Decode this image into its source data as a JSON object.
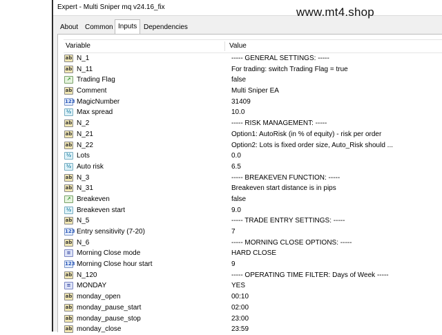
{
  "window": {
    "title": "Expert - Multi Sniper mq v24.16_fix",
    "watermark": "www.mt4.shop"
  },
  "tabs": [
    {
      "label": "About",
      "active": false
    },
    {
      "label": "Common",
      "active": false
    },
    {
      "label": "Inputs",
      "active": true
    },
    {
      "label": "Dependencies",
      "active": false
    }
  ],
  "table": {
    "headers": {
      "variable": "Variable",
      "value": "Value"
    },
    "rows": [
      {
        "icon": "ab",
        "name": "N_1",
        "value": "----- GENERAL SETTINGS: -----"
      },
      {
        "icon": "ab",
        "name": "N_11",
        "value": "For trading: switch Trading Flag = true"
      },
      {
        "icon": "bool",
        "name": "Trading Flag",
        "value": "false"
      },
      {
        "icon": "ab",
        "name": "Comment",
        "value": "Multi Sniper EA"
      },
      {
        "icon": "num",
        "name": "MagicNumber",
        "value": "31409"
      },
      {
        "icon": "dbl",
        "name": "Max spread",
        "value": "10.0"
      },
      {
        "icon": "ab",
        "name": "N_2",
        "value": "----- RISK MANAGEMENT: -----"
      },
      {
        "icon": "ab",
        "name": "N_21",
        "value": "Option1: AutoRisk (in % of equity) - risk per order"
      },
      {
        "icon": "ab",
        "name": "N_22",
        "value": "Option2: Lots is fixed order size, Auto_Risk should ..."
      },
      {
        "icon": "dbl",
        "name": "Lots",
        "value": "0.0"
      },
      {
        "icon": "dbl",
        "name": "Auto risk",
        "value": "6.5"
      },
      {
        "icon": "ab",
        "name": "N_3",
        "value": "-----  BREAKEVEN FUNCTION: -----"
      },
      {
        "icon": "ab",
        "name": "N_31",
        "value": "Breakeven start distance is in pips"
      },
      {
        "icon": "bool",
        "name": "Breakeven",
        "value": "false"
      },
      {
        "icon": "dbl",
        "name": "Breakeven start",
        "value": "9.0"
      },
      {
        "icon": "ab",
        "name": "N_5",
        "value": "----- TRADE ENTRY SETTINGS: -----"
      },
      {
        "icon": "num",
        "name": "Entry sensitivity (7-20)",
        "value": "7"
      },
      {
        "icon": "ab",
        "name": "N_6",
        "value": "----- MORNING CLOSE OPTIONS: -----"
      },
      {
        "icon": "enum",
        "name": "Morning Close mode",
        "value": "HARD CLOSE"
      },
      {
        "icon": "num",
        "name": "Morning Close hour start",
        "value": "9"
      },
      {
        "icon": "ab",
        "name": "N_120",
        "value": "----- OPERATING TIME FILTER: Days of Week -----"
      },
      {
        "icon": "enum",
        "name": "MONDAY",
        "value": "YES"
      },
      {
        "icon": "ab",
        "name": "monday_open",
        "value": "00:10"
      },
      {
        "icon": "ab",
        "name": "monday_pause_start",
        "value": "02:00"
      },
      {
        "icon": "ab",
        "name": "monday_pause_stop",
        "value": "23:00"
      },
      {
        "icon": "ab",
        "name": "monday_close",
        "value": "23:59"
      }
    ]
  },
  "icon_glyphs": {
    "ab": "ab",
    "bool": "↗",
    "num": "123",
    "dbl": "½",
    "enum": "≡"
  }
}
